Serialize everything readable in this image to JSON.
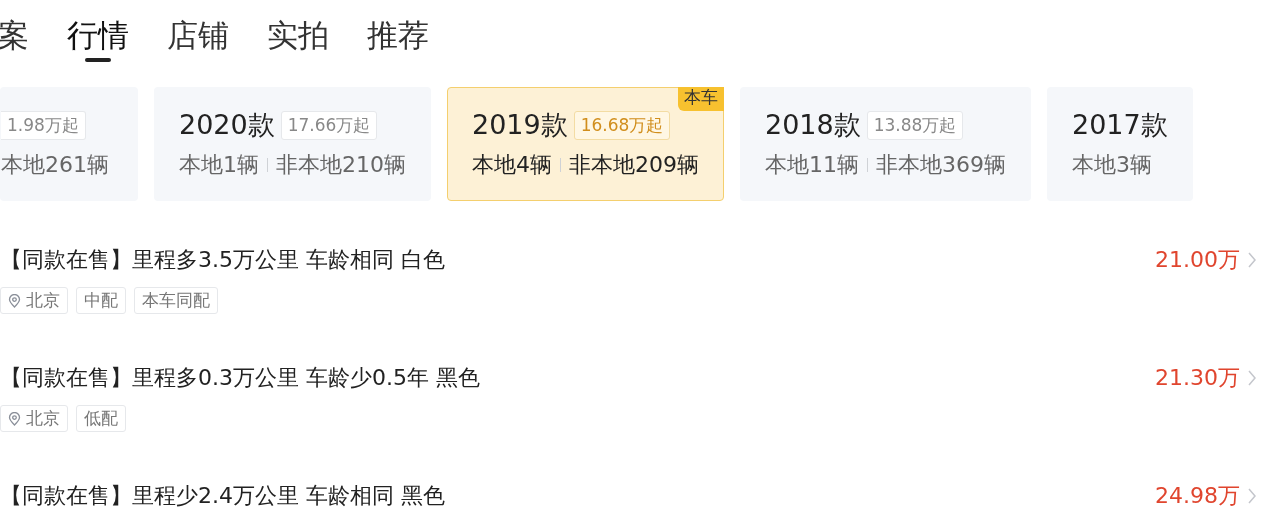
{
  "tabs": [
    {
      "label": "案",
      "selected": false
    },
    {
      "label": "行情",
      "selected": true
    },
    {
      "label": "店铺",
      "selected": false
    },
    {
      "label": "实拍",
      "selected": false
    },
    {
      "label": "推荐",
      "selected": false
    }
  ],
  "model_years": [
    {
      "price": "1.98万起",
      "nonlocal": "本地261辆",
      "selected": false
    },
    {
      "title": "2020款",
      "price": "17.66万起",
      "local": "本地1辆",
      "nonlocal": "非本地210辆",
      "selected": false
    },
    {
      "title": "2019款",
      "price": "16.68万起",
      "local": "本地4辆",
      "nonlocal": "非本地209辆",
      "selected": true,
      "badge": "本车"
    },
    {
      "title": "2018款",
      "price": "13.88万起",
      "local": "本地11辆",
      "nonlocal": "非本地369辆",
      "selected": false
    },
    {
      "title": "2017款",
      "local": "本地3辆",
      "selected": false
    }
  ],
  "listings": [
    {
      "title": "【同款在售】里程多3.5万公里 车龄相同 白色",
      "tags": [
        {
          "kind": "location",
          "label": "北京"
        },
        {
          "kind": "plain",
          "label": "中配"
        },
        {
          "kind": "plain",
          "label": "本车同配"
        }
      ],
      "price": "21.00万"
    },
    {
      "title": "【同款在售】里程多0.3万公里 车龄少0.5年 黑色",
      "tags": [
        {
          "kind": "location",
          "label": "北京"
        },
        {
          "kind": "plain",
          "label": "低配"
        }
      ],
      "price": "21.30万"
    },
    {
      "title": "【同款在售】里程少2.4万公里 车龄相同 黑色",
      "price": "24.98万"
    }
  ]
}
